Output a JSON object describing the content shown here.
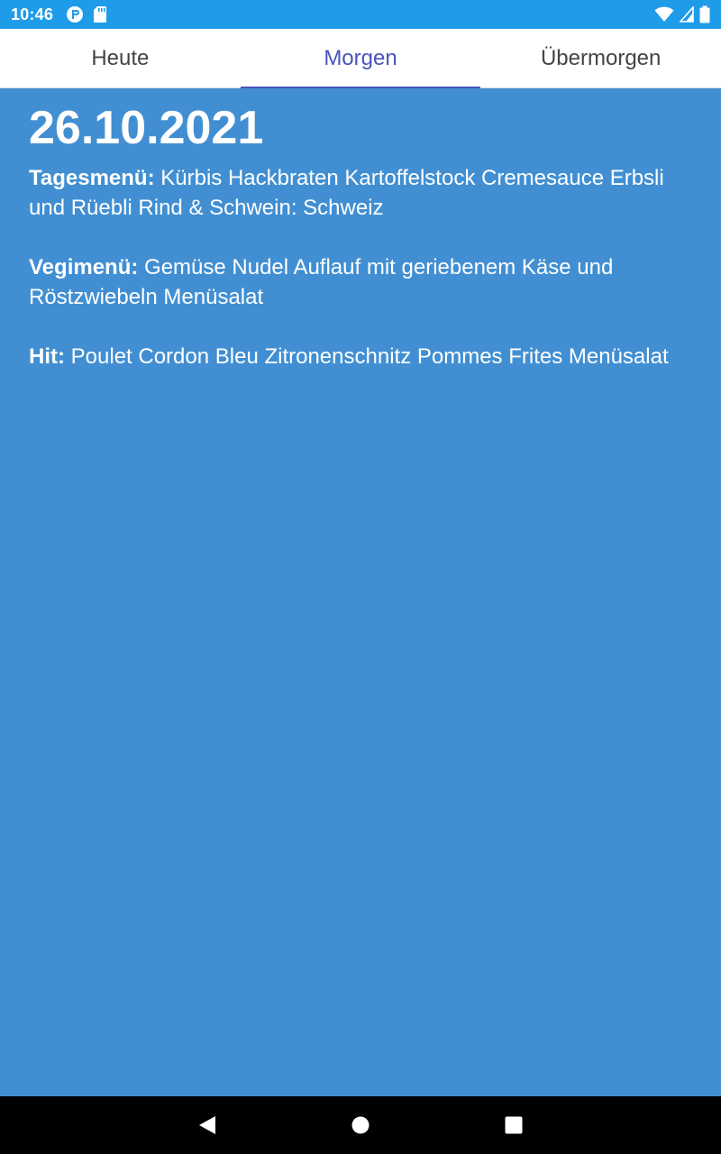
{
  "status_bar": {
    "time": "10:46",
    "left_icons": [
      "sync-badge-icon",
      "sd-card-icon"
    ],
    "right_icons": [
      "wifi-icon",
      "cell-signal-icon",
      "battery-icon"
    ]
  },
  "tabs": [
    {
      "label": "Heute",
      "active": false
    },
    {
      "label": "Morgen",
      "active": true
    },
    {
      "label": "Übermorgen",
      "active": false
    }
  ],
  "content": {
    "date": "26.10.2021",
    "menus": [
      {
        "label": "Tagesmenü:",
        "text": "Kürbis Hackbraten Kartoffelstock Cremesauce Erbsli und Rüebli Rind & Schwein: Schweiz"
      },
      {
        "label": "Vegimenü:",
        "text": "Gemüse Nudel Auflauf mit geriebenem Käse und Röstzwiebeln Menüsalat"
      },
      {
        "label": "Hit:",
        "text": "Poulet Cordon Bleu Zitronenschnitz Pommes Frites Menüsalat"
      }
    ]
  },
  "nav_bar": {
    "buttons": [
      "back-icon",
      "home-icon",
      "recents-icon"
    ]
  },
  "colors": {
    "status_bar": "#1e9be9",
    "content_background": "#418fd2",
    "active_tab": "#4654bd",
    "inactive_tab": "#444444",
    "nav_bar": "#000000"
  }
}
